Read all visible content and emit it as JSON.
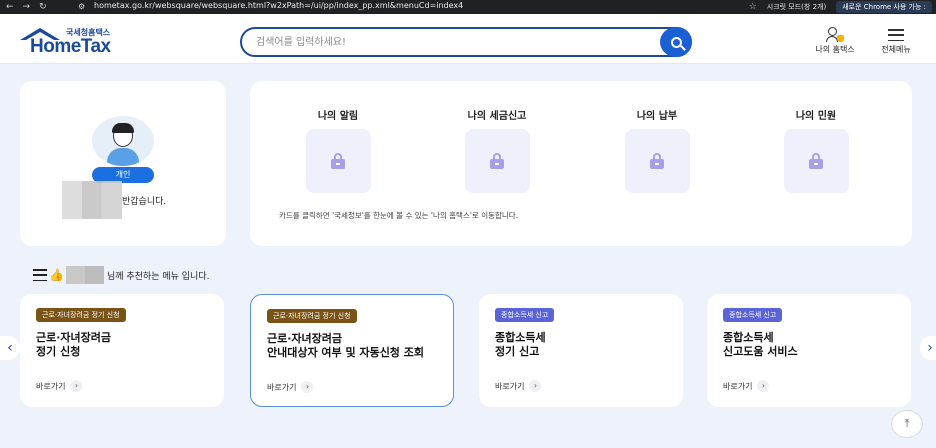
{
  "browser": {
    "url": "hometax.go.kr/websquare/websquare.html?w2xPath=/ui/pp/index_pp.xml&menuCd=index4",
    "incognito_label": "시크릿 모드(창 2개)",
    "new_chrome_label": "새로운 Chrome 사용 가능 :"
  },
  "header": {
    "logo_sub": "국세청홈택스",
    "logo_main": "HomeTax",
    "search_placeholder": "검색어를 입력하세요!",
    "my_hometax_label": "나의 홈택스",
    "all_menu_label": "전체메뉴"
  },
  "profile": {
    "badge": "개인",
    "greeting": "반갑습니다."
  },
  "my_area": {
    "items": [
      {
        "label": "나의 알림"
      },
      {
        "label": "나의 세금신고"
      },
      {
        "label": "나의 납부"
      },
      {
        "label": "나의 민원"
      }
    ],
    "note": "카드를 클릭하면 '국세정보'를 한눈에 볼 수 있는 '나의 홈택스'로 이동합니다."
  },
  "recommend": {
    "text": "님께 추천하는 메뉴 입니다."
  },
  "menu_cards": [
    {
      "tag": "근로·자녀장려금 정기 신청",
      "tag_color": "#7a5416",
      "title_lines": [
        "근로·자녀장려금",
        "정기 신청"
      ],
      "link": "바로가기"
    },
    {
      "tag": "근로·자녀장려금 정기 신청",
      "tag_color": "#7a5416",
      "title_lines": [
        "근로·자녀장려금",
        "안내대상자 여부 및 자동신청 조회"
      ],
      "link": "바로가기"
    },
    {
      "tag": "종합소득세 신고",
      "tag_color": "#5a63d8",
      "title_lines": [
        "종합소득세",
        "정기 신고"
      ],
      "link": "바로가기"
    },
    {
      "tag": "종합소득세 신고",
      "tag_color": "#5a63d8",
      "title_lines": [
        "종합소득세",
        "신고도움 서비스"
      ],
      "link": "바로가기"
    }
  ],
  "icons": {
    "search": "search-icon",
    "lock": "lock-icon",
    "arrow_left": "chevron-left-icon",
    "arrow_right": "chevron-right-icon",
    "scroll_top": "arrow-up-icon"
  }
}
